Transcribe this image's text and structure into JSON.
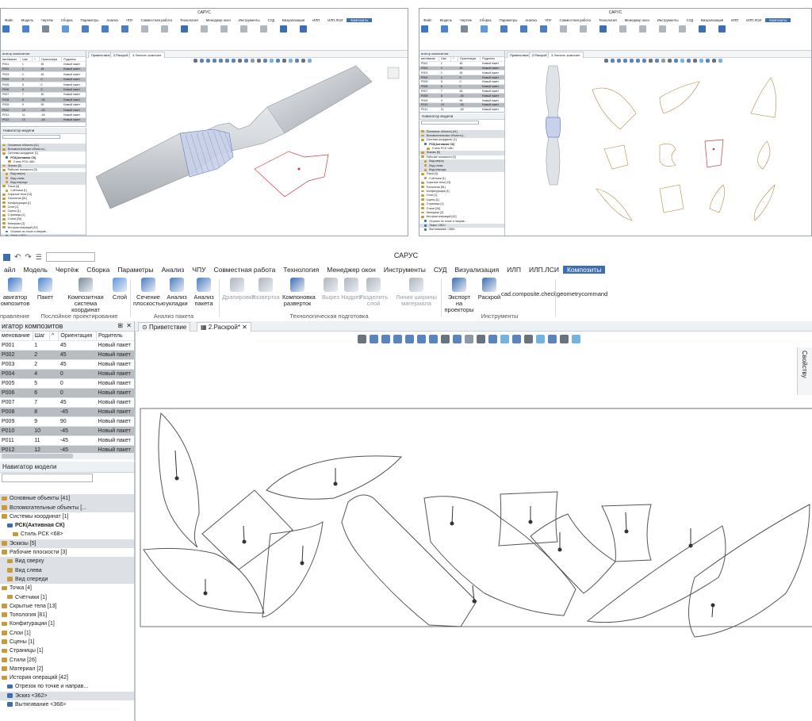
{
  "app_title": "САРУС",
  "menu": [
    "Файл",
    "Модель",
    "Чертёж",
    "Сборка",
    "Параметры",
    "Анализ",
    "ЧПУ",
    "Совместная работа",
    "Технология",
    "Менеджер окон",
    "Инструменты",
    "СУД",
    "Визуализация",
    "ИЛП",
    "ИЛП.ЛСИ",
    "Композиты"
  ],
  "menu_visible_first": "айл",
  "active_menu": "Композиты",
  "ribbon": {
    "buttons": [
      {
        "id": "nav",
        "l1": "авигатор",
        "l2": "омпозитов",
        "icon_color": "#3c78c8",
        "enabled": true
      },
      {
        "id": "pack",
        "l1": "Пакет",
        "l2": "",
        "icon_color": "#4a86d0",
        "enabled": true
      },
      {
        "id": "csys",
        "l1": "Композитная",
        "l2": "система координат",
        "icon_color": "#7a8a9a",
        "enabled": true
      },
      {
        "id": "layer",
        "l1": "Слой",
        "l2": "",
        "icon_color": "#5d9ad8",
        "enabled": true
      },
      {
        "id": "section",
        "l1": "Сечение",
        "l2": "плоскостью",
        "icon_color": "#4a7fbf",
        "enabled": true
      },
      {
        "id": "analysis_lay",
        "l1": "Анализ",
        "l2": "укладки",
        "icon_color": "#4a7fbf",
        "enabled": true
      },
      {
        "id": "analysis_pack",
        "l1": "Анализ",
        "l2": "пакета",
        "icon_color": "#4a7fbf",
        "enabled": true
      },
      {
        "id": "drape",
        "l1": "Драпировка",
        "l2": "",
        "icon_color": "#b0b6bd",
        "enabled": false
      },
      {
        "id": "unfold",
        "l1": "Развертка",
        "l2": "",
        "icon_color": "#b0b6bd",
        "enabled": false
      },
      {
        "id": "nesting",
        "l1": "Компоновка",
        "l2": "разверток",
        "icon_color": "#3d6eb1",
        "enabled": true
      },
      {
        "id": "cutout",
        "l1": "Вырез",
        "l2": "",
        "icon_color": "#b0b6bd",
        "enabled": false
      },
      {
        "id": "notch",
        "l1": "Надрез",
        "l2": "",
        "icon_color": "#b0b6bd",
        "enabled": false
      },
      {
        "id": "split",
        "l1": "Разделить",
        "l2": "слой",
        "icon_color": "#b0b6bd",
        "enabled": false
      },
      {
        "id": "width",
        "l1": "Линия ширины",
        "l2": "материала",
        "icon_color": "#b0b6bd",
        "enabled": false
      },
      {
        "id": "export",
        "l1": "Экспорт на",
        "l2": "проекторы",
        "icon_color": "#3d6eb1",
        "enabled": true
      },
      {
        "id": "cut",
        "l1": "Раскрой",
        "l2": "",
        "icon_color": "#3d6eb1",
        "enabled": true
      }
    ],
    "command_text": "cad.composite.checkgeometrycommand",
    "groups": [
      "правление",
      "Послойное проектирование",
      "Анализ пакета",
      "Технологическая подготовка",
      "Инструменты"
    ]
  },
  "composite_navigator": {
    "title": "игатор композитов",
    "columns": [
      "менование",
      "Шаг",
      "^",
      "Ориентация",
      "Родитель"
    ],
    "rows": [
      {
        "name": "P001",
        "step": "1",
        "orient": "45",
        "parent": "Новый пакет",
        "sel": false
      },
      {
        "name": "P002",
        "step": "2",
        "orient": "45",
        "parent": "Новый пакет",
        "sel": true
      },
      {
        "name": "P003",
        "step": "2",
        "orient": "45",
        "parent": "Новый пакет",
        "sel": false
      },
      {
        "name": "P004",
        "step": "4",
        "orient": "0",
        "parent": "Новый пакет",
        "sel": true
      },
      {
        "name": "P005",
        "step": "5",
        "orient": "0",
        "parent": "Новый пакет",
        "sel": false
      },
      {
        "name": "P006",
        "step": "6",
        "orient": "0",
        "parent": "Новый пакет",
        "sel": true
      },
      {
        "name": "P007",
        "step": "7",
        "orient": "45",
        "parent": "Новый пакет",
        "sel": false
      },
      {
        "name": "P008",
        "step": "8",
        "orient": "-45",
        "parent": "Новый пакет",
        "sel": true
      },
      {
        "name": "P009",
        "step": "9",
        "orient": "90",
        "parent": "Новый пакет",
        "sel": false
      },
      {
        "name": "P010",
        "step": "10",
        "orient": "-45",
        "parent": "Новый пакет",
        "sel": true
      },
      {
        "name": "P011",
        "step": "11",
        "orient": "-45",
        "parent": "Новый пакет",
        "sel": false
      },
      {
        "name": "P012",
        "step": "12",
        "orient": "-45",
        "parent": "Новый пакет",
        "sel": true
      }
    ]
  },
  "model_navigator": {
    "title": "Навигатор модели",
    "items": [
      {
        "label": "Основные объекты [41]",
        "color": "#c79a3a",
        "sel": true
      },
      {
        "label": "Вспомогательные объекты [...",
        "color": "#c79a3a",
        "sel": true
      },
      {
        "label": "Системы координат [1]",
        "color": "#c79a3a",
        "sel": false
      },
      {
        "label": "РСК(Активная СК)",
        "color": "#3d6eb1",
        "sel": false,
        "bold": true
      },
      {
        "label": "Стиль РСК <68>",
        "color": "#c79a3a",
        "sel": false
      },
      {
        "label": "Эскизы [5]",
        "color": "#c79a3a",
        "sel": true
      },
      {
        "label": "Рабочие плоскости [3]",
        "color": "#c79a3a",
        "sel": false
      },
      {
        "label": "Вид сверху",
        "color": "#c79a3a",
        "sel": true
      },
      {
        "label": "Вид слева",
        "color": "#c79a3a",
        "sel": true
      },
      {
        "label": "Вид спереди",
        "color": "#c79a3a",
        "sel": true
      },
      {
        "label": "Точка [4]",
        "color": "#c79a3a",
        "sel": false
      },
      {
        "label": "Счётчики [1]",
        "color": "#c79a3a",
        "sel": false
      },
      {
        "label": "Скрытые тела [13]",
        "color": "#c79a3a",
        "sel": false
      },
      {
        "label": "Топология [81]",
        "color": "#c79a3a",
        "sel": false
      },
      {
        "label": "Конфигурации [1]",
        "color": "#c79a3a",
        "sel": false
      },
      {
        "label": "Слои [1]",
        "color": "#c79a3a",
        "sel": false
      },
      {
        "label": "Сцены [1]",
        "color": "#c79a3a",
        "sel": false
      },
      {
        "label": "Страницы [1]",
        "color": "#c79a3a",
        "sel": false
      },
      {
        "label": "Стили [26]",
        "color": "#c79a3a",
        "sel": false
      },
      {
        "label": "Материал [2]",
        "color": "#c79a3a",
        "sel": false
      },
      {
        "label": "История операций [42]",
        "color": "#c79a3a",
        "sel": false
      },
      {
        "label": "Отрезок по точке и направ...",
        "color": "#3d6eb1",
        "sel": false
      },
      {
        "label": "Эскиз <362>",
        "color": "#3d6eb1",
        "sel": true
      },
      {
        "label": "Вытягивание <368>",
        "color": "#3d6eb1",
        "sel": false
      }
    ]
  },
  "tabs": [
    "Приветствие",
    "2.Раскрой*"
  ],
  "right_panel_label": "Свойству",
  "top_left_window": {
    "title": "САРУС",
    "tabs": [
      "Приветствие",
      "2.Раскрой",
      "3.Лопасть композит"
    ],
    "menu": [
      "Файл",
      "Модель",
      "Чертёж",
      "Сборка",
      "Параметры",
      "Анализ",
      "ЧПУ",
      "Совместная работа",
      "Технология",
      "Менеджер окон",
      "Инструменты",
      "СУД",
      "Визуализация",
      "ИЛП",
      "ИЛП.ЛСИ",
      "Композиты"
    ]
  },
  "top_right_window": {
    "title": "САРУС",
    "tabs": [
      "Приветствие",
      "2.Раскрой",
      "3.Лопасть композит"
    ],
    "menu": [
      "Файл",
      "Модель",
      "Чертёж",
      "Сборка",
      "Параметры",
      "Анализ",
      "ЧПУ",
      "Совместная работа",
      "Технология",
      "Менеджер окон",
      "Инструменты",
      "СУД",
      "Визуализация",
      "ИЛП",
      "ИЛП.ЛСИ",
      "Композиты"
    ]
  }
}
